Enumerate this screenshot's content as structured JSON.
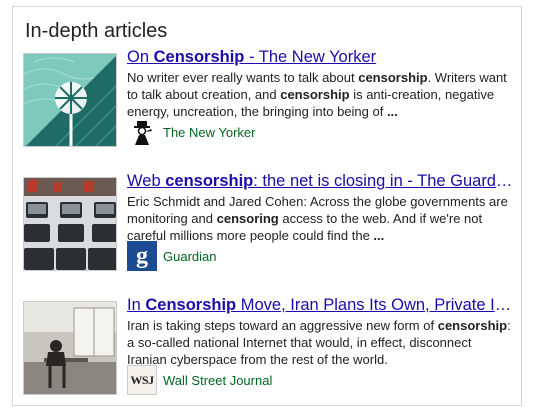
{
  "heading": "In-depth articles",
  "articles": [
    {
      "title_pre": "On ",
      "title_bold": "Censorship",
      "title_post": " - The New Yorker",
      "snippet": [
        {
          "t": "No writer ever really wants to talk about "
        },
        {
          "b": "censorship"
        },
        {
          "t": ". Writers want to talk about creation, and "
        },
        {
          "b": "censorship"
        },
        {
          "t": " is anti-creation, negative energy, uncreation, the bringing into being of "
        },
        {
          "b": "..."
        }
      ],
      "source": "The New Yorker",
      "thumb_icon": "windmill-illustration",
      "logo_icon": "eustace-tilley-icon"
    },
    {
      "title_pre": "Web ",
      "title_bold": "censorship",
      "title_post": ": the net is closing in - The Guardian",
      "snippet": [
        {
          "t": "Eric Schmidt and Jared Cohen: Across the globe governments are monitoring and "
        },
        {
          "b": "censoring"
        },
        {
          "t": " access to the web. And if we're not careful millions more people could find the "
        },
        {
          "b": "..."
        }
      ],
      "source": "Guardian",
      "logo_letter": "g",
      "thumb_icon": "internet-cafe-monitors-photo"
    },
    {
      "title_pre": "In ",
      "title_bold": "Censorship",
      "title_post": " Move, Iran Plans Its Own, Private Int…",
      "snippet": [
        {
          "t": "Iran is taking steps toward an aggressive new form of "
        },
        {
          "b": "censorship"
        },
        {
          "t": ": a so-called national Internet that would, in effect, disconnect Iranian cyberspace from the rest of the world."
        }
      ],
      "source": "Wall Street Journal",
      "logo_letter": "WSJ",
      "thumb_icon": "person-at-desk-photo"
    }
  ]
}
